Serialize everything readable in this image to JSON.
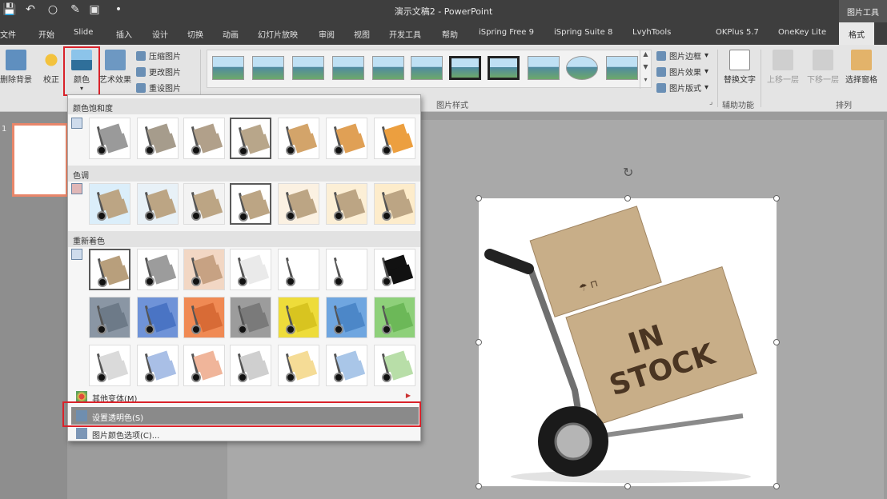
{
  "title_bar": {
    "title": "演示文稿2 - PowerPoint",
    "context_tab_group": "图片工具",
    "quick_access": [
      "save-icon",
      "undo-icon",
      "redo-icon",
      "format-painter-icon",
      "present-icon",
      "customize-icon"
    ]
  },
  "tabs": [
    "文件",
    "开始",
    "Slide",
    "插入",
    "设计",
    "切换",
    "动画",
    "幻灯片放映",
    "审阅",
    "视图",
    "开发工具",
    "帮助",
    "iSpring Free 9",
    "iSpring Suite 8",
    "LvyhTools",
    "OKPlus 5.7",
    "OneKey Lite",
    "格式"
  ],
  "active_tab": "格式",
  "ribbon": {
    "remove_bg": "删除背景",
    "corrections": "校正",
    "color": "颜色",
    "artistic_effects": "艺术效果",
    "compress": "压缩图片",
    "change_picture": "更改图片",
    "reset_picture": "重设图片",
    "picture_styles_label": "图片样式",
    "picture_border": "图片边框",
    "picture_effects": "图片效果",
    "picture_layout": "图片版式",
    "alt_text": "替换文字",
    "accessibility_label": "辅助功能",
    "bring_forward": "上移一层",
    "send_backward": "下移一层",
    "selection_pane": "选择窗格",
    "arrange_label": "排列"
  },
  "color_menu": {
    "saturation_heading": "颜色饱和度",
    "tone_heading": "色调",
    "recolor_heading": "重新着色",
    "more_variations": "其他变体(M)",
    "set_transparent": "设置透明色(S)",
    "color_options": "图片颜色选项(C)..."
  },
  "slide": {
    "thumbnail_number": "1",
    "picture_text_line1": "IN",
    "picture_text_line2": "STOCK"
  },
  "colors": {
    "accent_red": "#d9222a",
    "box_brown": "#c8ae88"
  }
}
